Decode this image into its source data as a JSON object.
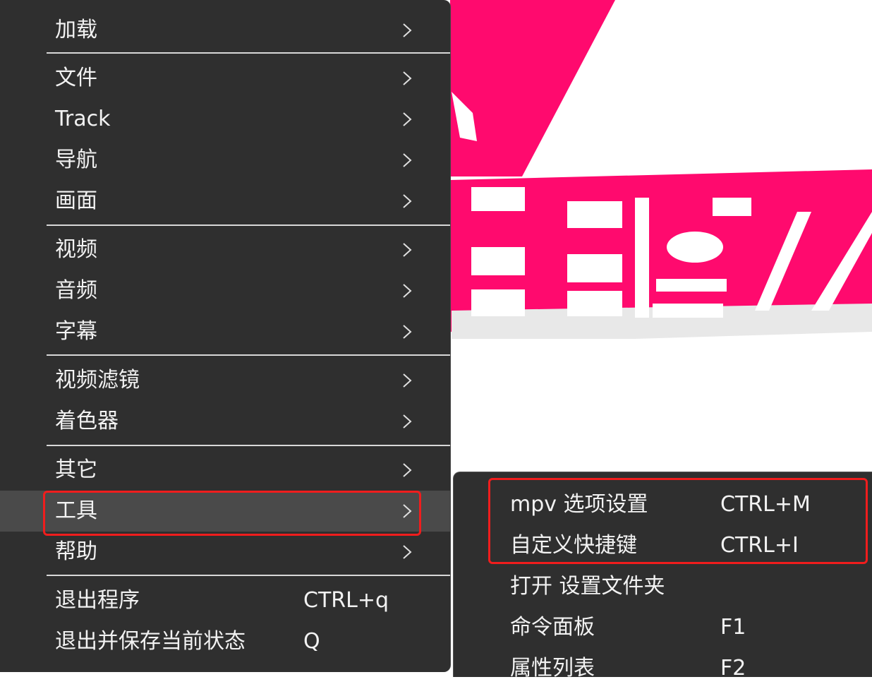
{
  "menu": {
    "items": [
      {
        "label": "加载",
        "has_submenu": true
      },
      {
        "label": "文件",
        "has_submenu": true
      },
      {
        "label": "Track",
        "has_submenu": true
      },
      {
        "label": "导航",
        "has_submenu": true
      },
      {
        "label": "画面",
        "has_submenu": true
      },
      {
        "label": "视频",
        "has_submenu": true
      },
      {
        "label": "音频",
        "has_submenu": true
      },
      {
        "label": "字幕",
        "has_submenu": true
      },
      {
        "label": "视频滤镜",
        "has_submenu": true
      },
      {
        "label": "着色器",
        "has_submenu": true
      },
      {
        "label": "其它",
        "has_submenu": true
      },
      {
        "label": "工具",
        "has_submenu": true,
        "state": "hovered"
      },
      {
        "label": "帮助",
        "has_submenu": true
      },
      {
        "label": "退出程序",
        "shortcut": "CTRL+q"
      },
      {
        "label": "退出并保存当前状态",
        "shortcut": "Q"
      }
    ]
  },
  "submenu": {
    "parent": "工具",
    "items": [
      {
        "label": "mpv 选项设置",
        "shortcut": "CTRL+M"
      },
      {
        "label": "自定义快捷键",
        "shortcut": "CTRL+I"
      },
      {
        "label": "打开 设置文件夹",
        "shortcut": ""
      },
      {
        "label": "命令面板",
        "shortcut": "F1"
      },
      {
        "label": "属性列表",
        "shortcut": "F2"
      }
    ]
  },
  "icons": {
    "submenu_arrow": "chevron-right-icon"
  },
  "colors": {
    "menu_bg": "#2f2f2f",
    "hover_bg": "#4a4a4a",
    "highlight_annotation": "#f01d1d",
    "background_accent": "#ff0a6e"
  }
}
